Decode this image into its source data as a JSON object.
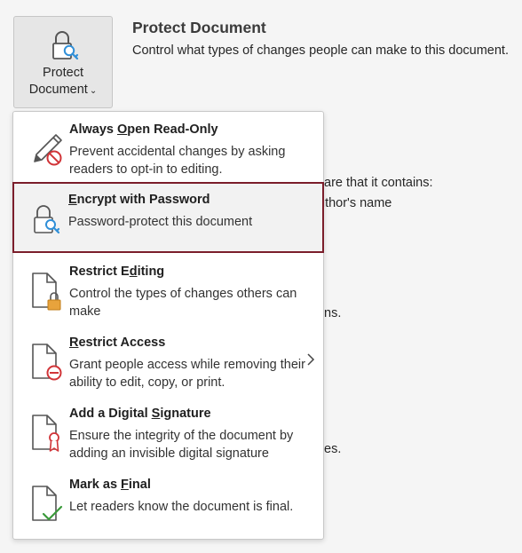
{
  "protect_button": {
    "label_line1": "Protect",
    "label_line2": "Document",
    "chevron": "⌄"
  },
  "section": {
    "title": "Protect Document",
    "description": "Control what types of changes people can make to this document."
  },
  "background_fragments": {
    "frag1": "are that it contains:",
    "frag2": "uthor's name",
    "frag3": "ns.",
    "frag4": "es."
  },
  "menu": {
    "items": [
      {
        "title_pre": "Always ",
        "title_key": "O",
        "title_post": "pen Read-Only",
        "description": "Prevent accidental changes by asking readers to opt-in to editing.",
        "icon": "pencil-prohibited-icon"
      },
      {
        "title_pre": "",
        "title_key": "E",
        "title_post": "ncrypt with Password",
        "description": "Password-protect this document",
        "icon": "lock-key-icon"
      },
      {
        "title_pre": "Restrict E",
        "title_key": "d",
        "title_post": "iting",
        "description": "Control the types of changes others can make",
        "icon": "document-lock-icon"
      },
      {
        "title_pre": "",
        "title_key": "R",
        "title_post": "estrict Access",
        "description": "Grant people access while removing their ability to edit, copy, or print.",
        "icon": "document-restricted-icon",
        "submenu_icon": "chevron-right-icon"
      },
      {
        "title_pre": "Add a Digital ",
        "title_key": "S",
        "title_post": "ignature",
        "description": "Ensure the integrity of the document by adding an invisible digital signature",
        "icon": "document-ribbon-icon"
      },
      {
        "title_pre": "Mark as ",
        "title_key": "F",
        "title_post": "inal",
        "description": "Let readers know the document is final.",
        "icon": "document-check-icon"
      }
    ]
  },
  "colors": {
    "selection_border": "#7b1e2b",
    "accent_blue": "#2f8fd8",
    "prohibited_red": "#d13438",
    "lock_gold": "#e8a33c",
    "check_green": "#3a9a3a"
  }
}
